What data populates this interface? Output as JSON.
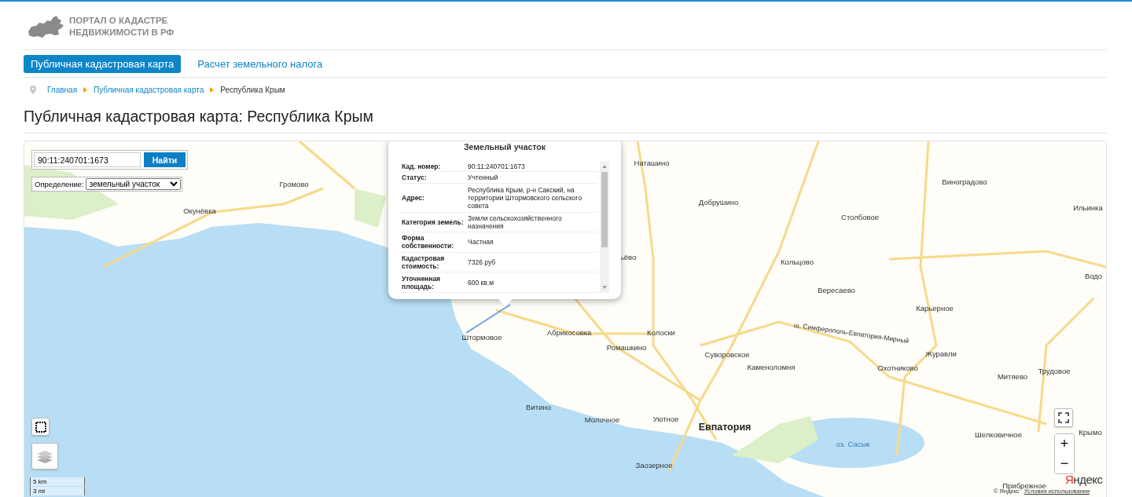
{
  "header": {
    "logo_lines": [
      "ПОРТАЛ О КАДАСТРЕ",
      "НЕДВИЖИМОСТИ В РФ"
    ]
  },
  "nav": [
    {
      "label": "Публичная кадастровая карта",
      "selected": true
    },
    {
      "label": "Расчет земельного налога",
      "selected": false
    }
  ],
  "breadcrumb": [
    {
      "label": "Главная",
      "kind": "link"
    },
    {
      "label": "Публичная кадастровая карта",
      "kind": "link"
    },
    {
      "label": "Республика Крым",
      "kind": "current"
    }
  ],
  "page_title": "Публичная кадастровая карта: Республика Крым",
  "map": {
    "search": {
      "value": "90:11:240701:1673",
      "button": "Найти"
    },
    "definition": {
      "label": "Определение:",
      "value": "земельный участок"
    },
    "popup": {
      "title": "Земельный участок",
      "rows": [
        {
          "label": "Кад. номер:",
          "value": "90:11:240701:1673"
        },
        {
          "label": "Статус:",
          "value": "Учтенный"
        },
        {
          "label": "Адрес:",
          "value": "Республика Крым, р-н Сакский, на территории Штормовского сельского совета"
        },
        {
          "label": "Категория земель:",
          "value": "Земли сельскохозяйственного назначения"
        },
        {
          "label": "Форма собственности:",
          "value": "Частная"
        },
        {
          "label": "Кадастровая стоимость:",
          "value": "7326 руб"
        },
        {
          "label": "Уточненная площадь:",
          "value": "600 кв.м"
        }
      ]
    },
    "place_labels": [
      {
        "text": "Громово",
        "kind": "town"
      },
      {
        "text": "Окунёвка",
        "kind": "town"
      },
      {
        "text": "Наташино",
        "kind": "town"
      },
      {
        "text": "Добрушино",
        "kind": "town"
      },
      {
        "text": "Столбовое",
        "kind": "town"
      },
      {
        "text": "Виноградово",
        "kind": "town"
      },
      {
        "text": "Ильинка",
        "kind": "town"
      },
      {
        "text": "Кольцово",
        "kind": "town"
      },
      {
        "text": "Вересаево",
        "kind": "town"
      },
      {
        "text": "Водо",
        "kind": "town"
      },
      {
        "text": "ьёво",
        "kind": "town"
      },
      {
        "text": "Карьерное",
        "kind": "town"
      },
      {
        "text": "Штормовое",
        "kind": "town"
      },
      {
        "text": "Абрикосовка",
        "kind": "town"
      },
      {
        "text": "Колоски",
        "kind": "town"
      },
      {
        "text": "Ромашкино",
        "kind": "town"
      },
      {
        "text": "Суворовское",
        "kind": "town"
      },
      {
        "text": "Каменоломня",
        "kind": "town"
      },
      {
        "text": "Журавли",
        "kind": "town"
      },
      {
        "text": "Охотниково",
        "kind": "town"
      },
      {
        "text": "Митяево",
        "kind": "town"
      },
      {
        "text": "Трудовое",
        "kind": "town"
      },
      {
        "text": "ш. Симферополь-Евпатория-Мирный",
        "kind": "road"
      },
      {
        "text": "Витино",
        "kind": "town"
      },
      {
        "text": "Молочное",
        "kind": "town"
      },
      {
        "text": "Уютное",
        "kind": "town"
      },
      {
        "text": "Евпатория",
        "kind": "city"
      },
      {
        "text": "оз. Сасык",
        "kind": "water"
      },
      {
        "text": "Шелковичное",
        "kind": "town"
      },
      {
        "text": "Крымо",
        "kind": "town"
      },
      {
        "text": "Заозерное",
        "kind": "town"
      },
      {
        "text": "Прибрежное",
        "kind": "town"
      }
    ],
    "scale": [
      "5 km",
      "3 mi"
    ],
    "zoom": {
      "in": "+",
      "out": "−"
    },
    "logo": "Яндекс",
    "copyright": "© Яндекс",
    "terms": "Условия использования"
  }
}
